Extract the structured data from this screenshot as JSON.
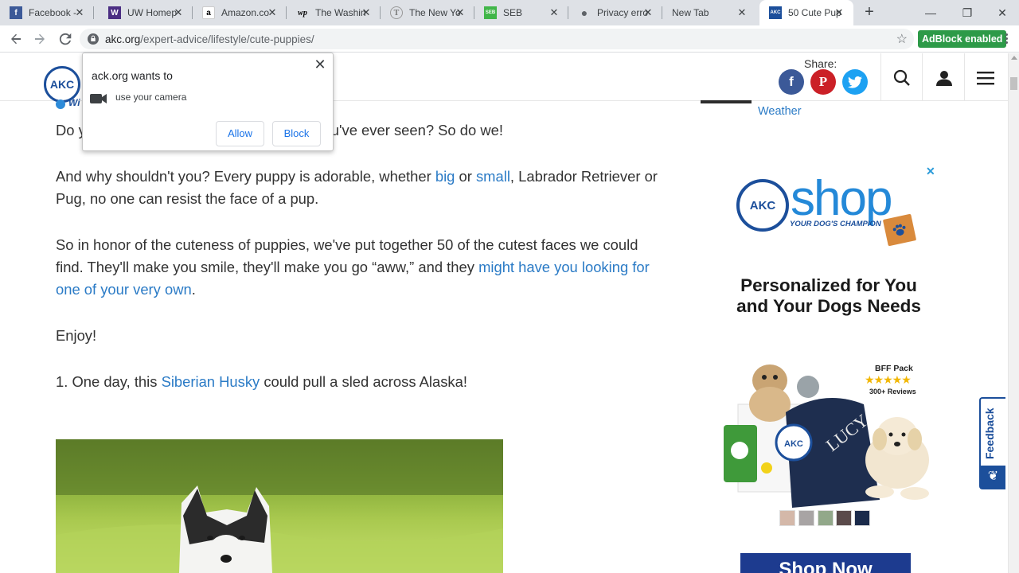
{
  "browser": {
    "tabs": [
      {
        "title": "Facebook -",
        "favicon": "f",
        "favicon_bg": "#3b5998",
        "favicon_fg": "#ffffff",
        "icon_name": "facebook-icon"
      },
      {
        "title": "UW Homep",
        "favicon": "W",
        "favicon_bg": "#4b2e83",
        "favicon_fg": "#ffffff",
        "icon_name": "uw-icon"
      },
      {
        "title": "Amazon.co",
        "favicon": "a",
        "favicon_bg": "#ffffff",
        "favicon_fg": "#000000",
        "icon_name": "amazon-icon"
      },
      {
        "title": "The Washin",
        "favicon": "wp",
        "favicon_bg": "#dee1e6",
        "favicon_fg": "#000000",
        "icon_name": "washington-post-icon"
      },
      {
        "title": "The New Yo",
        "favicon": "T",
        "favicon_bg": "#dee1e6",
        "favicon_fg": "#555555",
        "icon_name": "nytimes-icon"
      },
      {
        "title": "SEB",
        "favicon": "SEB",
        "favicon_bg": "#41b649",
        "favicon_fg": "#ffffff",
        "icon_name": "seb-icon"
      },
      {
        "title": "Privacy erro",
        "favicon": "●",
        "favicon_bg": "#dee1e6",
        "favicon_fg": "#5f6368",
        "icon_name": "globe-icon"
      },
      {
        "title": "New Tab",
        "favicon": "",
        "favicon_bg": "#dee1e6",
        "favicon_fg": "#000000",
        "icon_name": "blank-icon"
      },
      {
        "title": "50 Cute Pup",
        "favicon": "AKC",
        "favicon_bg": "#1c4f9b",
        "favicon_fg": "#ffffff",
        "icon_name": "akc-icon"
      }
    ],
    "tab_close_glyph": "✕",
    "new_tab_glyph": "+",
    "window_controls": {
      "minimize": "—",
      "maximize": "❐",
      "close": "✕"
    },
    "url_host": "akc.org",
    "url_path": "/expert-advice/lifestyle/cute-puppies/",
    "bookmark_glyph": "☆",
    "adblock_label": "AdBlock enabled",
    "adblock_color": "#2d9a48"
  },
  "permission": {
    "title": "ack.org wants to",
    "message": "use your camera",
    "allow": "Allow",
    "block": "Block",
    "close_glyph": "✕"
  },
  "header": {
    "logo_text": "AKC",
    "logo_tag_fragment": "Wi",
    "share_label": "Share:",
    "share": [
      {
        "glyph": "f",
        "color": "#3b5998",
        "name": "facebook-share-icon"
      },
      {
        "glyph": "P",
        "color": "#cb2027",
        "name": "pinterest-share-icon"
      },
      {
        "glyph": "t",
        "color": "#1da1f2",
        "name": "twitter-share-icon"
      }
    ]
  },
  "article": {
    "p1_visible": "py you've ever seen? So do we!",
    "p1_hidden_start": "Do y",
    "p2_a": "And why shouldn't you? Every puppy is adorable, whether ",
    "p2_link1": "big",
    "p2_b": " or ",
    "p2_link2": "small",
    "p2_c": ", Labrador Retriever or Pug, no one can resist the face of a pup.",
    "p3_a": "So in honor of the cuteness of puppies, we've put together 50 of the cutest faces we could find. They'll make you smile, they'll make you go “aww,” and they ",
    "p3_link": "might have you looking for one of your very own",
    "p3_b": ".",
    "p4": "Enjoy!",
    "p5_a": "1. One day, this ",
    "p5_link": "Siberian Husky",
    "p5_b": " could pull a sled across Alaska!"
  },
  "sidebar": {
    "weather_link": "Weather",
    "ad": {
      "close_glyph": "✕",
      "seal_text": "AKC",
      "shop_word": "shop",
      "tagline": "YOUR DOG'S CHAMPION",
      "headline": "Personalized for You and Your Dogs Needs",
      "pack_title": "BFF Pack",
      "pack_stars": "★★★★★",
      "pack_reviews": "300+ Reviews",
      "name_on_blanket": "LUCY",
      "swatches": [
        "#d4b8a9",
        "#a8a4a4",
        "#92a88a",
        "#5a4a4a",
        "#1a2a4a"
      ],
      "cta": "Shop Now"
    }
  },
  "feedback": {
    "label": "Feedback",
    "icon": "❦"
  }
}
